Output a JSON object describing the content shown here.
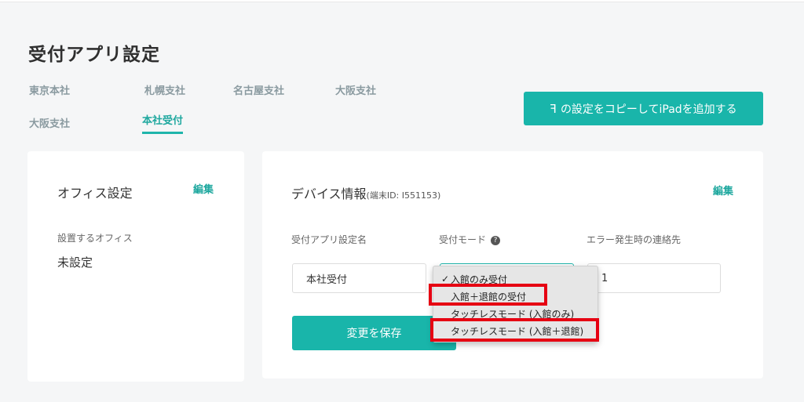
{
  "page": {
    "title": "受付アプリ設定"
  },
  "tabs": [
    {
      "label": "東京本社"
    },
    {
      "label": "札幌支社"
    },
    {
      "label": "名古屋支社"
    },
    {
      "label": "大阪支社"
    },
    {
      "label": "大阪支社"
    },
    {
      "label": "本社受付",
      "active": true
    }
  ],
  "copy_button": {
    "icon": "copy-symbol",
    "label": "の設定をコピーしてiPadを追加する"
  },
  "office_card": {
    "title": "オフィス設定",
    "edit_label": "編集",
    "field_label": "設置するオフィス",
    "field_value": "未設定"
  },
  "device_card": {
    "title": "デバイス情報",
    "terminal_id": "(端末ID: I551153)",
    "edit_label": "編集",
    "name_label": "受付アプリ設定名",
    "name_value": "本社受付",
    "mode_label": "受付モード",
    "help_icon": "?",
    "contact_label": "エラー発生時の連絡先",
    "contact_value": "1",
    "save_label": "変更を保存"
  },
  "mode_dropdown": {
    "selected": "入館のみ受付",
    "check": "✓",
    "options": [
      "入館のみ受付",
      "入館＋退館の受付",
      "タッチレスモード (入館のみ)",
      "タッチレスモード (入館＋退館)"
    ]
  },
  "colors": {
    "accent": "#19b5aa",
    "highlight": "#e60012",
    "background": "#f5f6f7"
  }
}
